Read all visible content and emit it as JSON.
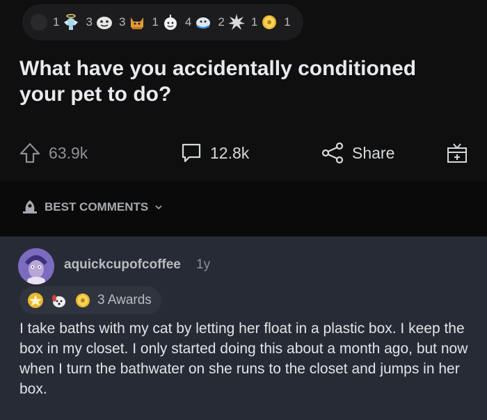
{
  "post": {
    "awards": [
      {
        "icon": "award-dot-icon",
        "count": ""
      },
      {
        "icon": "angel-icon",
        "count": "1"
      },
      {
        "icon": "face-icon",
        "count": "3"
      },
      {
        "icon": "cat-icon",
        "count": "3"
      },
      {
        "icon": "wholesome-icon",
        "count": "1"
      },
      {
        "icon": "hug-icon",
        "count": "4"
      },
      {
        "icon": "starburst-icon",
        "count": "2"
      },
      {
        "icon": "gold-icon",
        "count": "1"
      },
      {
        "icon": "helpful-icon",
        "count": "1"
      }
    ],
    "title": "What have you accidentally conditioned your pet to do?",
    "upvotes": "63.9k",
    "comments": "12.8k",
    "share_label": "Share"
  },
  "sorter": {
    "label": "BEST COMMENTS"
  },
  "comment": {
    "username": "aquickcupofcoffee",
    "age": "1y",
    "awards_label": "3 Awards",
    "body": "I take baths with my cat by letting her float in a plastic box. I keep the box in my closet. I only started doing this about a month ago, but now when I turn the bathwater on she runs to the closet and jumps in her box."
  },
  "colors": {
    "background": "#0e0e0f",
    "comment_background": "#272b35",
    "award_gold": "#e8b72c",
    "text_muted": "#8d9095"
  }
}
